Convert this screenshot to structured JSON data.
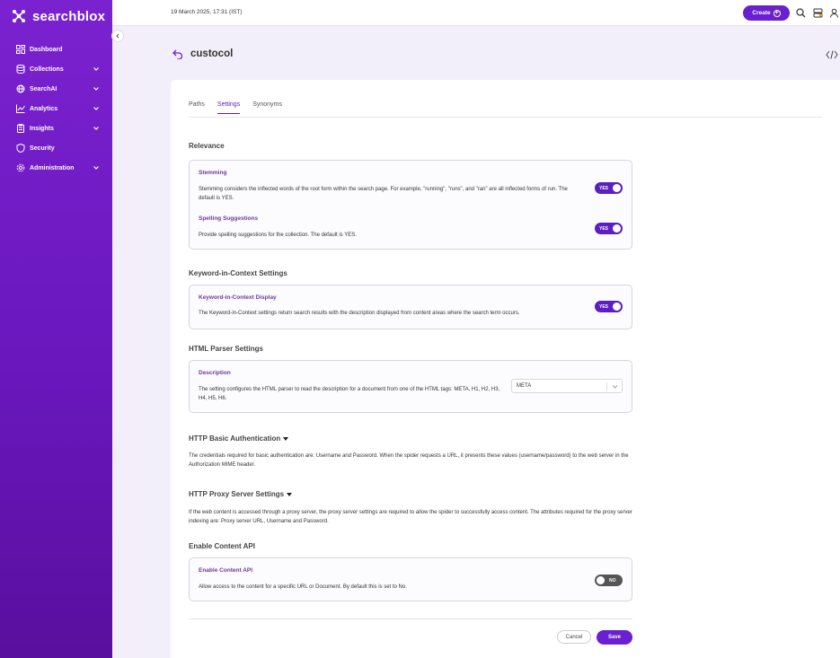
{
  "app": {
    "name": "searchblox"
  },
  "topbar": {
    "datetime": "19 March 2025, 17:31 (IST)",
    "create_label": "Create"
  },
  "sidebar": {
    "items": [
      {
        "label": "Dashboard",
        "icon": "dashboard-icon",
        "has_chevron": false
      },
      {
        "label": "Collections",
        "icon": "collections-icon",
        "has_chevron": true
      },
      {
        "label": "SearchAI",
        "icon": "searchai-icon",
        "has_chevron": true
      },
      {
        "label": "Analytics",
        "icon": "analytics-icon",
        "has_chevron": true
      },
      {
        "label": "Insights",
        "icon": "insights-icon",
        "has_chevron": true
      },
      {
        "label": "Security",
        "icon": "shield-icon",
        "has_chevron": false
      },
      {
        "label": "Administration",
        "icon": "gear-icon",
        "has_chevron": true
      }
    ]
  },
  "page": {
    "title": "custocol"
  },
  "tabs": [
    {
      "label": "Paths",
      "active": false
    },
    {
      "label": "Settings",
      "active": true
    },
    {
      "label": "Synonyms",
      "active": false
    }
  ],
  "relevance": {
    "title": "Relevance",
    "stemming": {
      "label": "Stemming",
      "desc": "Stemming considers the inflected words of the root form within the search page. For example, \"running\", \"runs\", and \"ran\" are all inflected forms of run. The default is YES.",
      "toggle": "YES"
    },
    "spelling": {
      "label": "Spelling Suggestions",
      "desc": "Provide spelling suggestions for the collection. The default is YES.",
      "toggle": "YES"
    }
  },
  "kwic": {
    "title": "Keyword-in-Context Settings",
    "display": {
      "label": "Keyword-in-Context Display",
      "desc": "The Keyword-in-Context settings return search results with the description displayed from content areas where the search term occurs.",
      "toggle": "YES"
    }
  },
  "html_parser": {
    "title": "HTML Parser Settings",
    "description": {
      "label": "Description",
      "desc": "The setting configures the HTML parser to read the description for a document from one of the HTML tags: META, H1, H2, H3, H4, H5, H6.",
      "selected": "META"
    }
  },
  "http_basic": {
    "title": "HTTP Basic Authentication",
    "desc": "The credentials required for basic authentication are: Username and Password. When the spider requests a URL, it presents these values (username/password) to the web server in the Authorization MIME header."
  },
  "http_proxy": {
    "title": "HTTP Proxy Server Settings",
    "desc": "If the web content is accessed through a proxy server, the proxy server settings are required to allow the spider to successfully access content. The attributes required for the proxy server indexing are: Proxy server URL, Username and Password."
  },
  "content_api": {
    "title": "Enable Content API",
    "item": {
      "label": "Enable Content API",
      "desc": "Allow access to the content for a specific URL or Document. By default this is set to No.",
      "toggle": "NO"
    }
  },
  "footer": {
    "cancel_label": "Cancel",
    "save_label": "Save"
  },
  "colors": {
    "brand": "#6a1fd0",
    "sidebar": "#7a22cf",
    "toggle_on": "#5b1fbf",
    "toggle_off": "#555555"
  }
}
